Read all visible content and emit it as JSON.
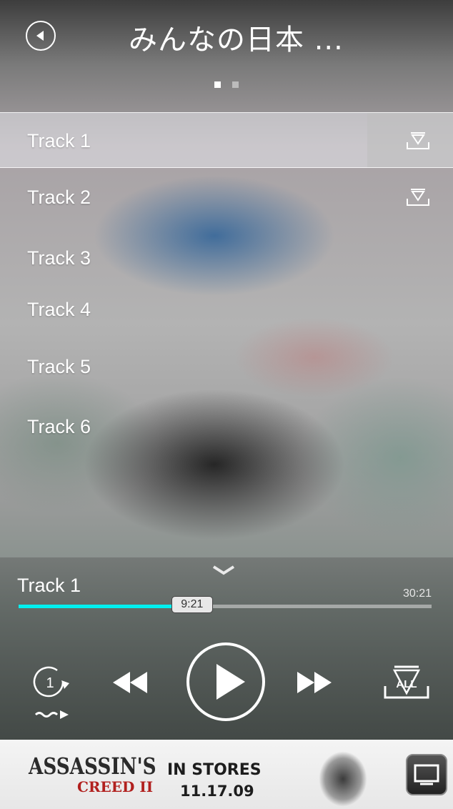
{
  "header": {
    "title": "みんなの日本 ...",
    "page_indicator": {
      "pages": 2,
      "current": 1
    }
  },
  "tracks": [
    {
      "label": "Track 1",
      "selected": true,
      "download_icon": "download-icon"
    },
    {
      "label": "Track 2",
      "selected": false,
      "download_icon": "download-icon"
    },
    {
      "label": "Track 3",
      "selected": false
    },
    {
      "label": "Track 4",
      "selected": false
    },
    {
      "label": "Track 5",
      "selected": false
    },
    {
      "label": "Track 6",
      "selected": false
    }
  ],
  "player": {
    "now_playing": "Track 1",
    "elapsed": "9:21",
    "duration": "30:21",
    "progress_fraction": 0.37,
    "accent_color": "#00f0f0",
    "repeat_count": "1",
    "download_all_label": "ALL",
    "icons": [
      "repeat-one-icon",
      "shuffle-icon",
      "rewind-icon",
      "play-icon",
      "fast-forward-icon",
      "download-all-icon",
      "collapse-chevron-icon"
    ]
  },
  "ad": {
    "brand": "ASSASSIN'S",
    "subtitle": "CREED II",
    "stores_text": "IN STORES",
    "date": "11.17.09"
  }
}
